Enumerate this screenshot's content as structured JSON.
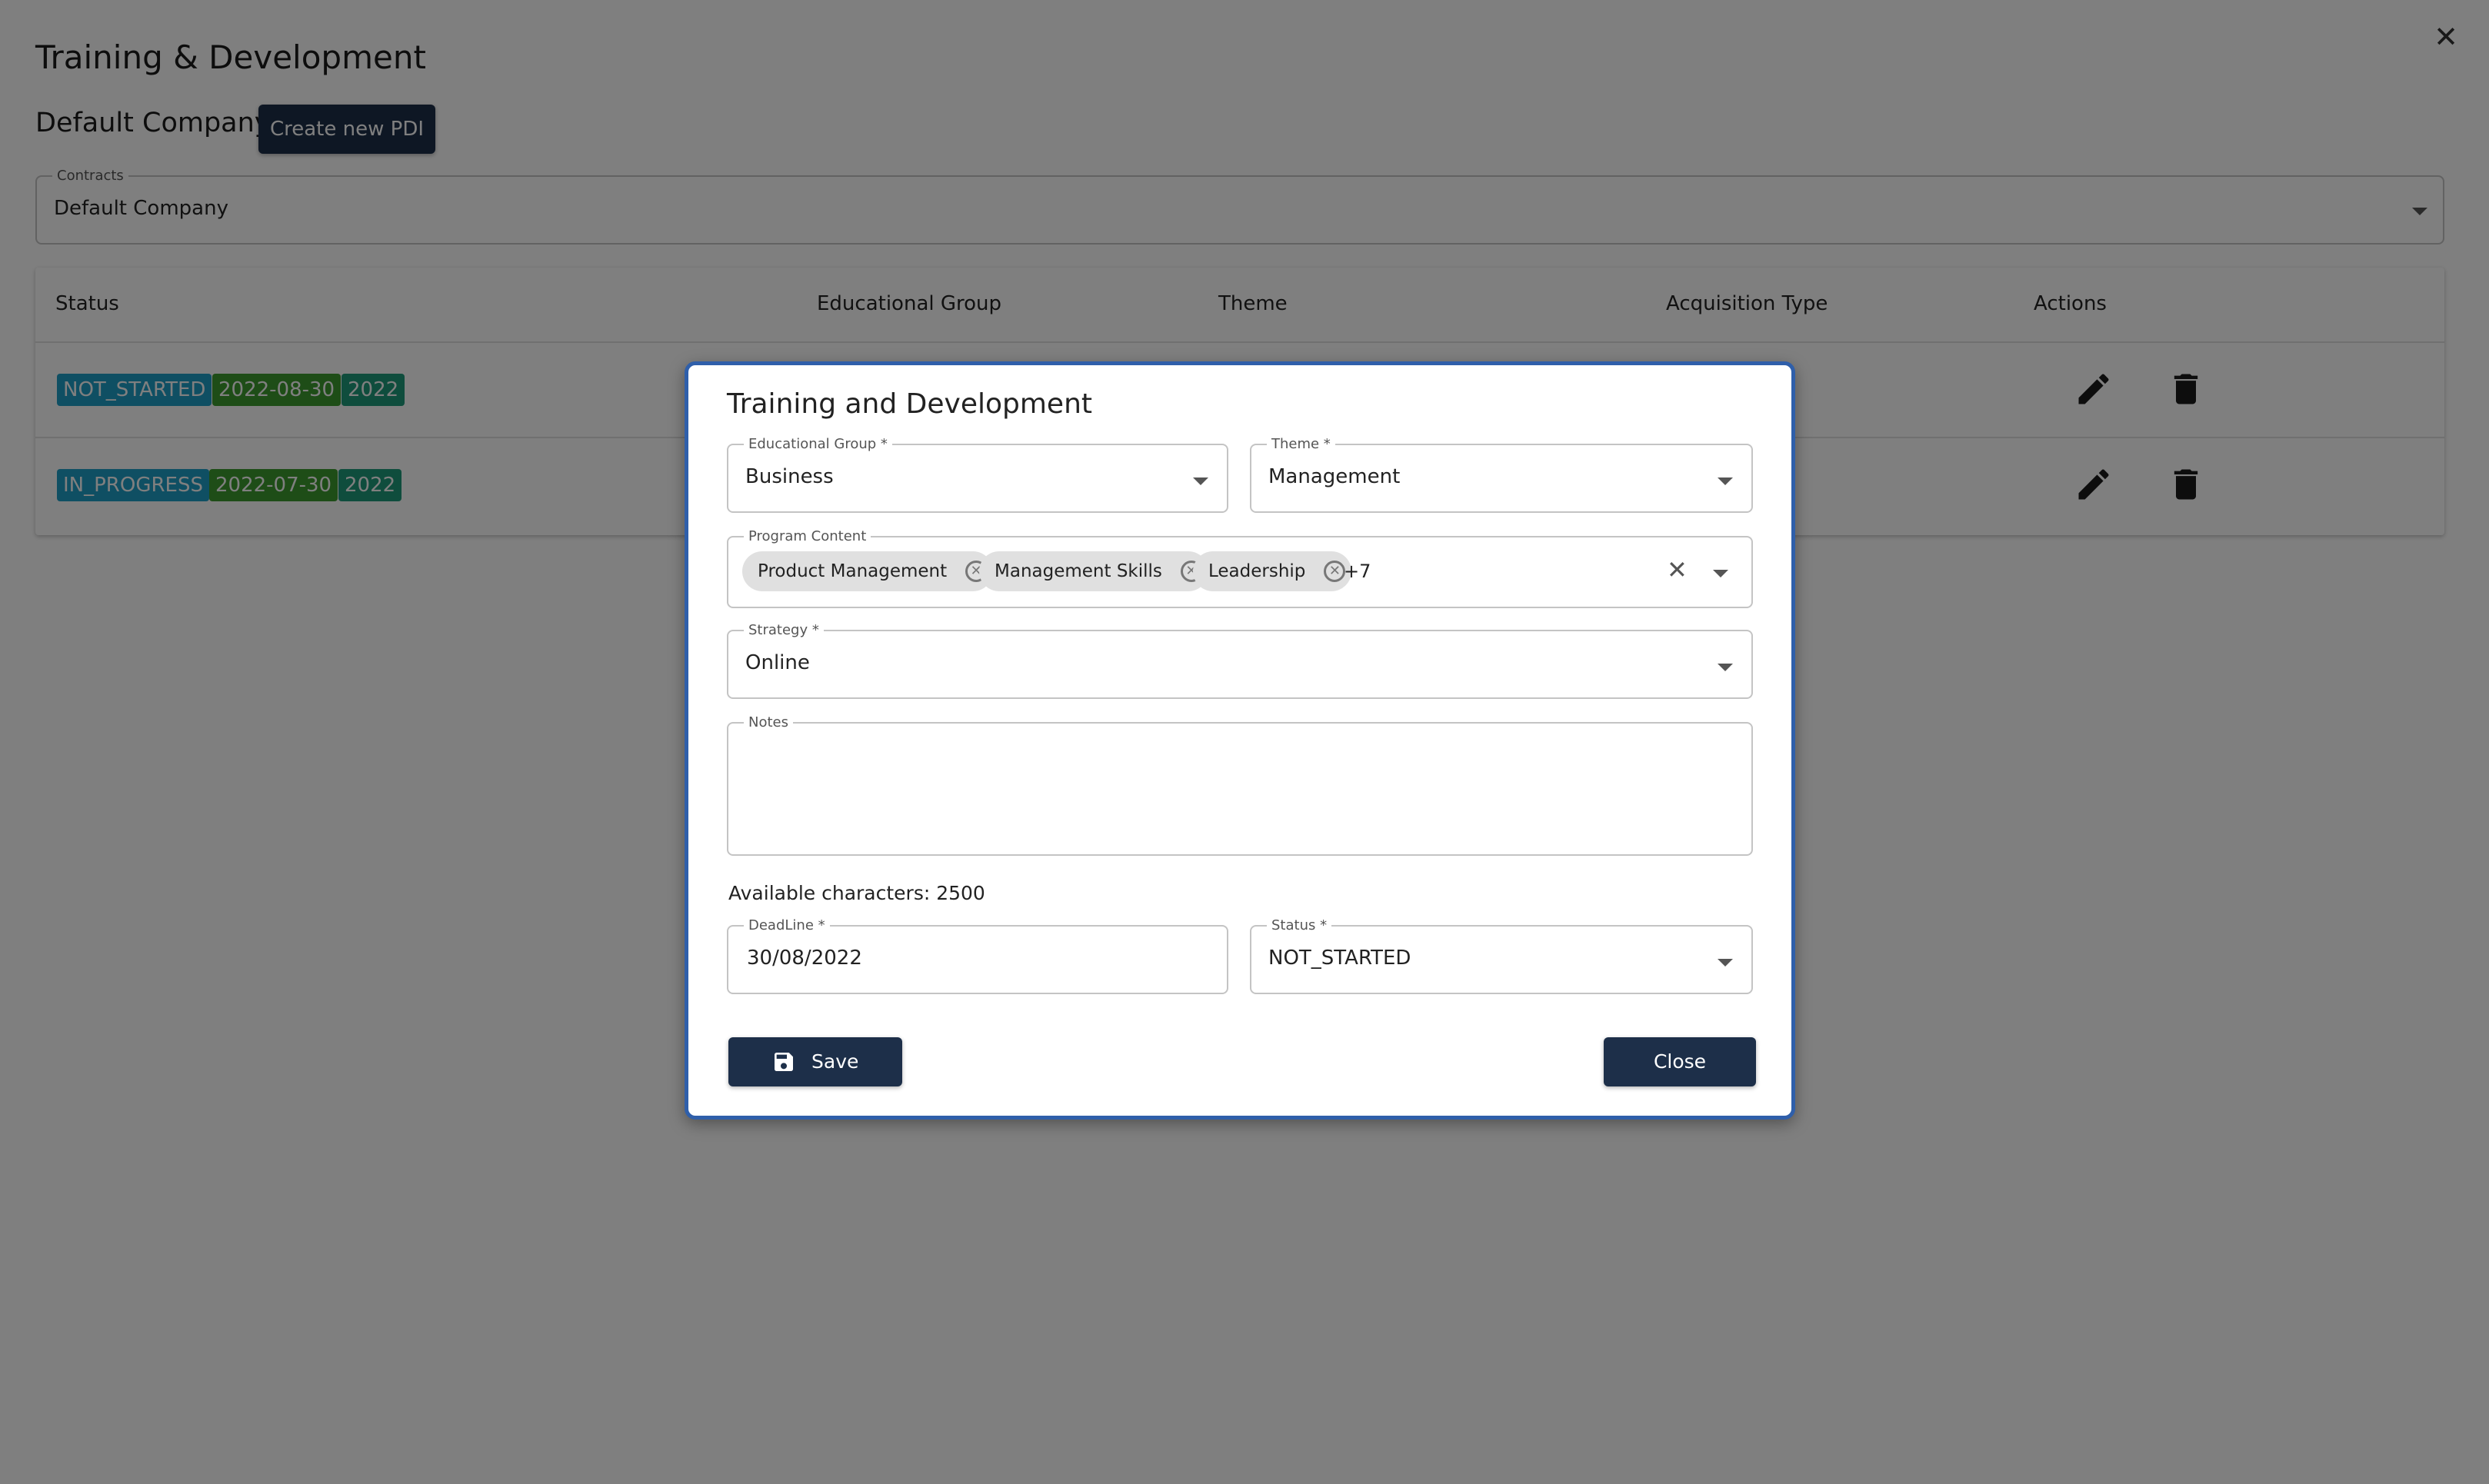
{
  "page": {
    "title": "Training & Development",
    "company_name": "Default Company",
    "create_button": "Create new PDI",
    "contracts": {
      "label": "Contracts",
      "value": "Default Company"
    }
  },
  "table": {
    "headers": [
      "Status",
      "Educational Group",
      "Theme",
      "Acquisition Type",
      "Actions"
    ],
    "rows": [
      {
        "status": "NOT_STARTED",
        "date": "2022-08-30",
        "year": "2022"
      },
      {
        "status": "IN_PROGRESS",
        "date": "2022-07-30",
        "year": "2022"
      }
    ]
  },
  "modal": {
    "title": "Training and Development",
    "educational_group": {
      "label": "Educational Group *",
      "value": "Business"
    },
    "theme": {
      "label": "Theme *",
      "value": "Management"
    },
    "program_content": {
      "label": "Program Content",
      "chips": [
        "Product Management",
        "Management Skills",
        "Leadership"
      ],
      "more": "+7"
    },
    "strategy": {
      "label": "Strategy *",
      "value": "Online"
    },
    "notes": {
      "label": "Notes",
      "value": ""
    },
    "available_characters": "Available characters: 2500",
    "deadline": {
      "label": "DeadLine *",
      "value": "30/08/2022"
    },
    "status": {
      "label": "Status *",
      "value": "NOT_STARTED"
    },
    "save_label": "Save",
    "close_label": "Close"
  },
  "colors": {
    "primary_button": "#1d2f49",
    "badge_status": "#1f9fc6",
    "badge_date": "#3c9a2e",
    "badge_year": "#1f9a7a",
    "modal_border": "#2f5faa"
  }
}
